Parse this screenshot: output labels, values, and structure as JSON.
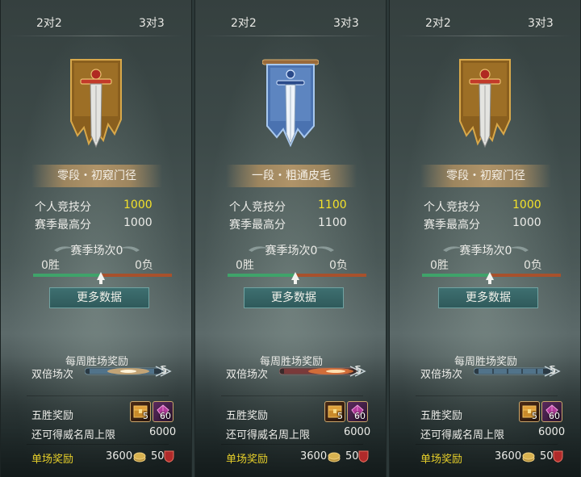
{
  "panels": [
    {
      "tab_2v2": "2对2",
      "tab_3v3": "3对3",
      "emblem": "gold-sword-banner-icon",
      "rank_title": "零段・初窥门径",
      "personal_score_label": "个人竞技分",
      "personal_score": "1000",
      "season_high_label": "赛季最高分",
      "season_high": "1000",
      "season_matches": "赛季场次0",
      "wins": "0胜",
      "losses": "0负",
      "more_data_label": "更多数据",
      "weekly_reward_title": "每周胜场奖励",
      "double_label": "双倍场次",
      "double_count": "5",
      "five_win_label": "五胜奖励",
      "five_win_items": [
        "5",
        "60"
      ],
      "remaining_cap_label": "还可得威名周上限",
      "remaining_cap": "6000",
      "single_reward_label": "单场奖励",
      "single_reward_coins": "3600",
      "single_reward_shield": "50"
    },
    {
      "tab_2v2": "2对2",
      "tab_3v3": "3对3",
      "emblem": "blue-sword-banner-icon",
      "rank_title": "一段・粗通皮毛",
      "personal_score_label": "个人竞技分",
      "personal_score": "1100",
      "season_high_label": "赛季最高分",
      "season_high": "1100",
      "season_matches": "赛季场次0",
      "wins": "0胜",
      "losses": "0负",
      "more_data_label": "更多数据",
      "weekly_reward_title": "每周胜场奖励",
      "double_label": "双倍场次",
      "double_count": "5",
      "five_win_label": "五胜奖励",
      "five_win_items": [
        "5",
        "60"
      ],
      "remaining_cap_label": "还可得威名周上限",
      "remaining_cap": "6000",
      "single_reward_label": "单场奖励",
      "single_reward_coins": "3600",
      "single_reward_shield": "50"
    },
    {
      "tab_2v2": "2对2",
      "tab_3v3": "3对3",
      "emblem": "gold-sword-banner-icon",
      "rank_title": "零段・初窥门径",
      "personal_score_label": "个人竞技分",
      "personal_score": "1000",
      "season_high_label": "赛季最高分",
      "season_high": "1000",
      "season_matches": "赛季场次0",
      "wins": "0胜",
      "losses": "0负",
      "more_data_label": "更多数据",
      "weekly_reward_title": "每周胜场奖励",
      "double_label": "双倍场次",
      "double_count": "5",
      "five_win_label": "五胜奖励",
      "five_win_items": [
        "5",
        "60"
      ],
      "remaining_cap_label": "还可得威名周上限",
      "remaining_cap": "6000",
      "single_reward_label": "单场奖励",
      "single_reward_coins": "3600",
      "single_reward_shield": "50"
    }
  ],
  "colors": {
    "score_highlight": "#f3e12a",
    "single_reward_label": "#e6cf2a",
    "win_bar": "#3fa36a",
    "loss_bar": "#a8512c",
    "button_bg": "#2f5a5b"
  }
}
